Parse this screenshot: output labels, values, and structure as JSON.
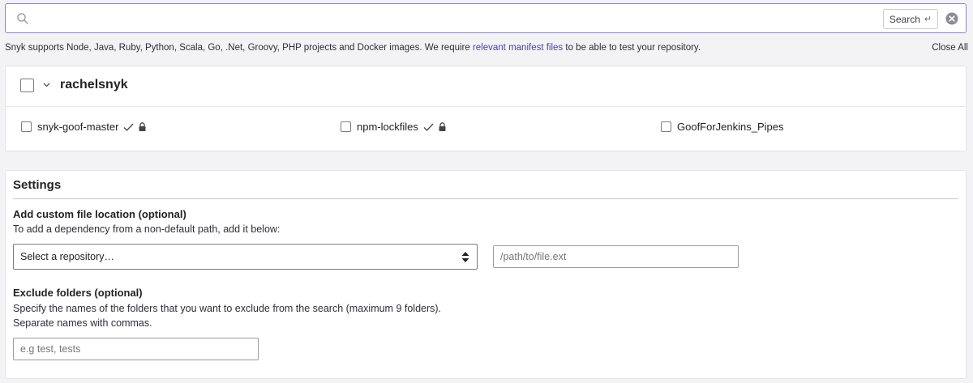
{
  "search": {
    "value": "",
    "button_label": "Search",
    "enter_glyph": "↵",
    "search_icon": "search-icon",
    "clear_icon": "clear-icon"
  },
  "info": {
    "text_before": "Snyk supports Node, Java, Ruby, Python, Scala, Go, .Net, Groovy, PHP projects and Docker images. We require ",
    "link_text": "relevant manifest files",
    "text_after": " to be able to test your repository.",
    "close_all": "Close All"
  },
  "org": {
    "name": "rachelsnyk",
    "repos": [
      {
        "name": "snyk-goof-master",
        "checked": false,
        "imported": true,
        "private": true
      },
      {
        "name": "npm-lockfiles",
        "checked": false,
        "imported": true,
        "private": true
      },
      {
        "name": "GoofForJenkins_Pipes",
        "checked": false,
        "imported": false,
        "private": false
      }
    ]
  },
  "settings": {
    "title": "Settings",
    "custom_location": {
      "label": "Add custom file location (optional)",
      "help": "To add a dependency from a non-default path, add it below:",
      "select_value": "Select a repository…",
      "path_placeholder": "/path/to/file.ext"
    },
    "exclude": {
      "label": "Exclude folders (optional)",
      "help_line1": "Specify the names of the folders that you want to exclude from the search (maximum 9 folders).",
      "help_line2": "Separate names with commas.",
      "placeholder": "e.g test, tests"
    }
  },
  "colors": {
    "accent": "#4b45a1",
    "focus_border": "#8a86c8",
    "background": "#f3f3f5"
  }
}
